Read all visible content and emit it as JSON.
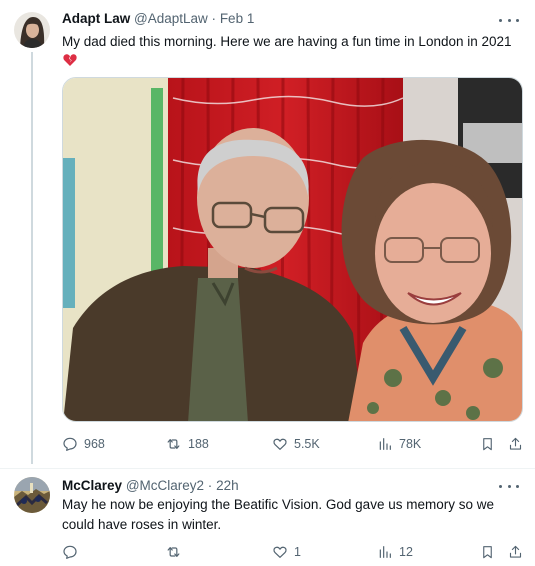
{
  "main_tweet": {
    "author_name": "Adapt Law",
    "handle": "@AdaptLaw",
    "separator": "·",
    "date": "Feb 1",
    "text": "My dad died this morning.  Here we are having a fun time in London in 2021",
    "emoji": "💔",
    "media_alt": "photo-of-elderly-man-and-woman-smiling-in-front-of-red-curtain",
    "stats": {
      "replies": "968",
      "retweets": "188",
      "likes": "5.5K",
      "views": "78K"
    }
  },
  "reply_tweet": {
    "author_name": "McClarey",
    "handle": "@McClarey2",
    "separator": "·",
    "date": "22h",
    "text": "May he now be enjoying the Beatific Vision.  God gave us memory so we could have roses in winter.",
    "stats": {
      "replies": "",
      "retweets": "",
      "likes": "1",
      "views": "12"
    }
  },
  "colors": {
    "text_primary": "#0f1419",
    "text_secondary": "#536471",
    "thread_line": "#cfd9de",
    "heart_red": "#f4212e"
  },
  "icons": {
    "more": "more-horizontal-icon",
    "reply": "reply-bubble-icon",
    "retweet": "retweet-icon",
    "like": "heart-icon",
    "views": "bar-chart-icon",
    "bookmark": "bookmark-icon",
    "share": "share-upload-icon"
  }
}
